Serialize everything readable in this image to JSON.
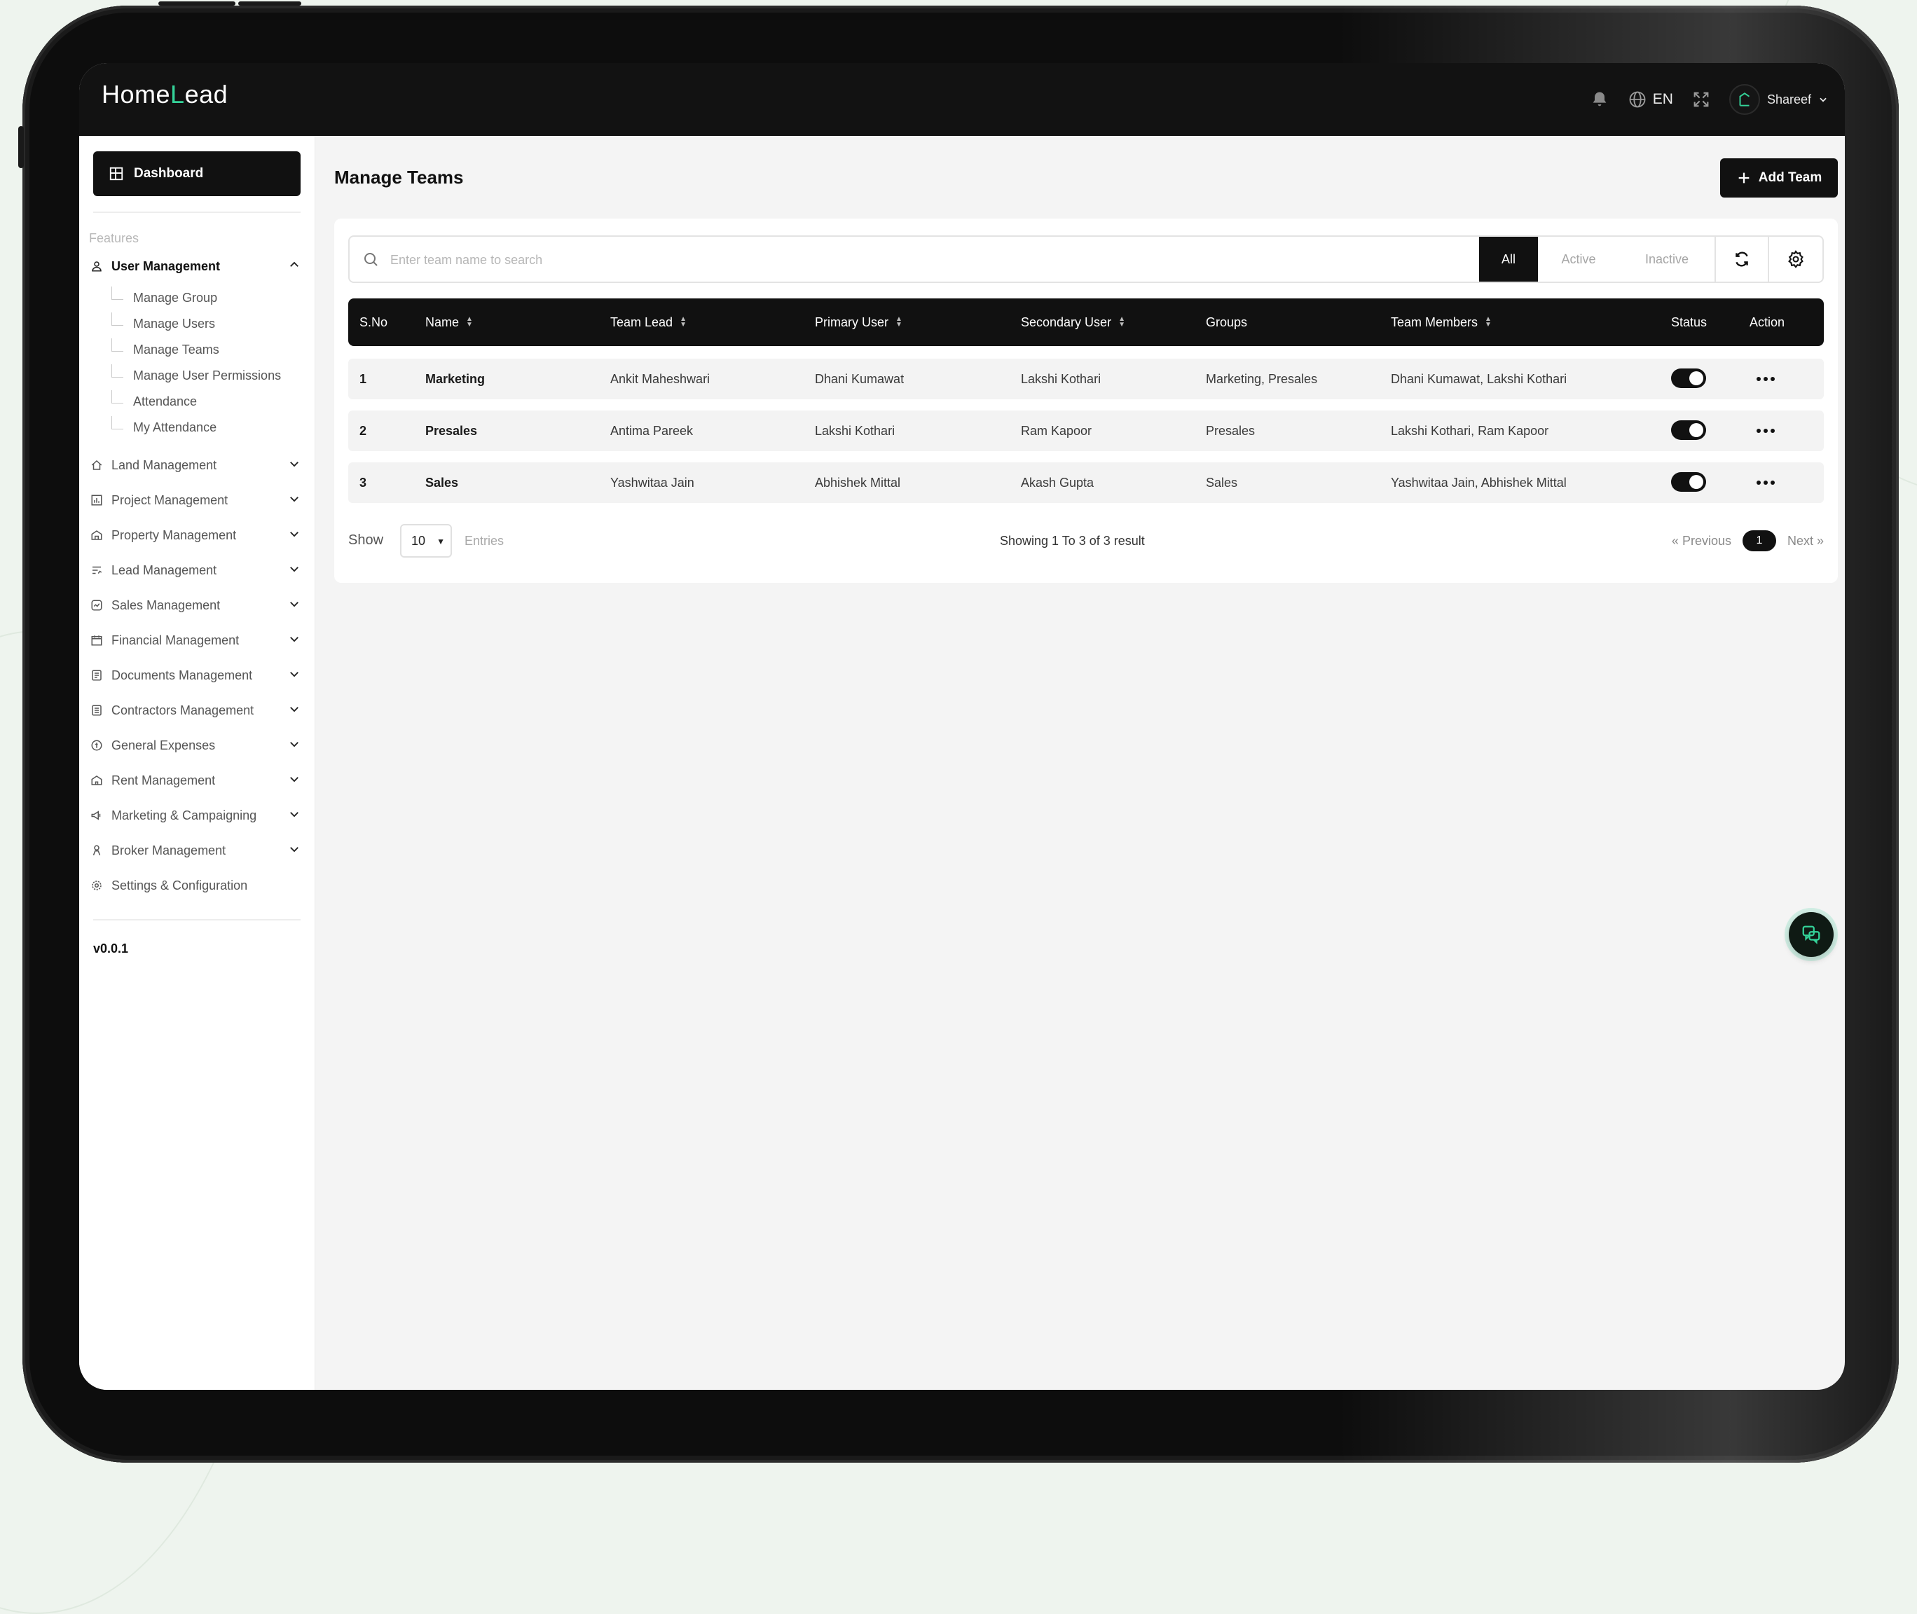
{
  "app": {
    "logo_text_left": "Home",
    "logo_text_right": "ead",
    "language": "EN",
    "user_name": "Shareef",
    "version": "v0.0.1"
  },
  "sidebar": {
    "dashboard_label": "Dashboard",
    "section_label": "Features",
    "user_management": {
      "label": "User Management",
      "sub_items": [
        "Manage Group",
        "Manage Users",
        "Manage Teams",
        "Manage User Permissions",
        "Attendance",
        "My Attendance"
      ]
    },
    "items": [
      {
        "label": "Land Management",
        "icon": "land-icon"
      },
      {
        "label": "Project Management",
        "icon": "project-icon"
      },
      {
        "label": "Property Management",
        "icon": "property-icon"
      },
      {
        "label": "Lead Management",
        "icon": "lead-icon"
      },
      {
        "label": "Sales Management",
        "icon": "sales-icon"
      },
      {
        "label": "Financial Management",
        "icon": "financial-icon"
      },
      {
        "label": "Documents Management",
        "icon": "documents-icon"
      },
      {
        "label": "Contractors Management",
        "icon": "contractors-icon"
      },
      {
        "label": "General Expenses",
        "icon": "expenses-icon"
      },
      {
        "label": "Rent Management",
        "icon": "rent-icon"
      },
      {
        "label": "Marketing & Campaigning",
        "icon": "megaphone-icon"
      },
      {
        "label": "Broker Management",
        "icon": "broker-icon"
      },
      {
        "label": "Settings & Configuration",
        "icon": "gear-icon"
      }
    ]
  },
  "main": {
    "title": "Manage Teams",
    "add_button_label": "Add Team",
    "search_placeholder": "Enter team name to search",
    "filters": [
      "All",
      "Active",
      "Inactive"
    ],
    "active_filter": "All",
    "table": {
      "headers": [
        "S.No",
        "Name",
        "Team Lead",
        "Primary User",
        "Secondary User",
        "Groups",
        "Team Members",
        "Status",
        "Action"
      ],
      "rows": [
        {
          "sno": "1",
          "name": "Marketing",
          "team_lead": "Ankit Maheshwari",
          "primary_user": "Dhani Kumawat",
          "secondary_user": "Lakshi Kothari",
          "groups": "Marketing, Presales",
          "members": "Dhani Kumawat, Lakshi Kothari",
          "status": true
        },
        {
          "sno": "2",
          "name": "Presales",
          "team_lead": "Antima Pareek",
          "primary_user": "Lakshi Kothari",
          "secondary_user": "Ram Kapoor",
          "groups": "Presales",
          "members": "Lakshi Kothari, Ram Kapoor",
          "status": true
        },
        {
          "sno": "3",
          "name": "Sales",
          "team_lead": "Yashwitaa Jain",
          "primary_user": "Abhishek Mittal",
          "secondary_user": "Akash Gupta",
          "groups": "Sales",
          "members": "Yashwitaa Jain, Abhishek Mittal",
          "status": true
        }
      ]
    },
    "pagination": {
      "show_label": "Show",
      "page_size": "10",
      "entries_label": "Entries",
      "summary": "Showing 1 To 3 of 3 result",
      "previous_label": "Previous",
      "next_label": "Next",
      "current_page": "1"
    }
  },
  "colors": {
    "accent": "#34d399",
    "primary": "#111111",
    "background": "#f4f4f4"
  }
}
